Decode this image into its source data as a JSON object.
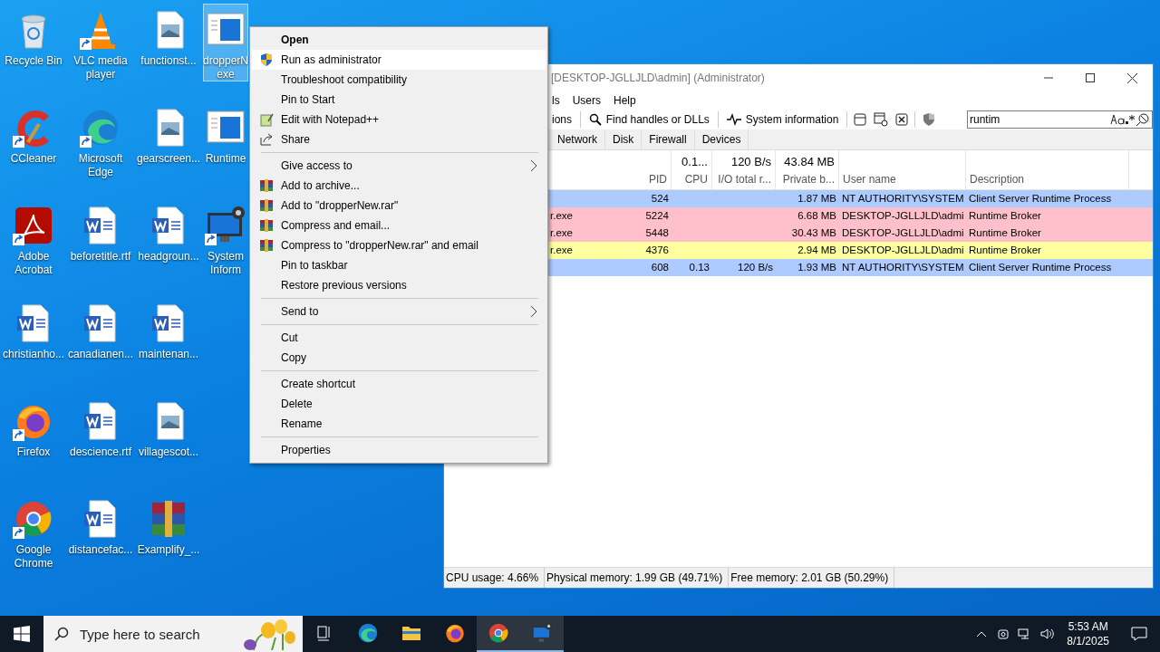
{
  "desktop_icons": [
    {
      "label": "Recycle Bin",
      "kind": "recycle",
      "shortcut": false,
      "selected": false
    },
    {
      "label": "CCleaner",
      "kind": "ccleaner",
      "shortcut": true,
      "selected": false
    },
    {
      "label": "Adobe Acrobat",
      "kind": "acrobat",
      "shortcut": true,
      "selected": false
    },
    {
      "label": "christianho...",
      "kind": "word",
      "shortcut": false,
      "selected": false
    },
    {
      "label": "Firefox",
      "kind": "firefox",
      "shortcut": true,
      "selected": false
    },
    {
      "label": "Google Chrome",
      "kind": "chrome",
      "shortcut": true,
      "selected": false
    },
    {
      "label": "VLC media player",
      "kind": "vlc",
      "shortcut": true,
      "selected": false
    },
    {
      "label": "Microsoft Edge",
      "kind": "edge",
      "shortcut": true,
      "selected": false
    },
    {
      "label": "beforetitle.rtf",
      "kind": "word",
      "shortcut": false,
      "selected": false
    },
    {
      "label": "canadianen...",
      "kind": "word",
      "shortcut": false,
      "selected": false
    },
    {
      "label": "descience.rtf",
      "kind": "word",
      "shortcut": false,
      "selected": false
    },
    {
      "label": "distancefac...",
      "kind": "word",
      "shortcut": false,
      "selected": false
    },
    {
      "label": "functionst...",
      "kind": "image",
      "shortcut": false,
      "selected": false
    },
    {
      "label": "gearscreen...",
      "kind": "image",
      "shortcut": false,
      "selected": false
    },
    {
      "label": "headgroun...",
      "kind": "word",
      "shortcut": false,
      "selected": false
    },
    {
      "label": "maintenan...",
      "kind": "word",
      "shortcut": false,
      "selected": false
    },
    {
      "label": "villagescot...",
      "kind": "image",
      "shortcut": false,
      "selected": false
    },
    {
      "label": "Examplify_...",
      "kind": "winrar",
      "shortcut": false,
      "selected": false
    },
    {
      "label": "dropperN exe",
      "kind": "app",
      "shortcut": false,
      "selected": true
    },
    {
      "label": "Runtime",
      "kind": "app",
      "shortcut": false,
      "selected": false
    },
    {
      "label": "System Inform",
      "kind": "sysinfo",
      "shortcut": true,
      "selected": false
    }
  ],
  "process_window": {
    "title": "[DESKTOP-JGLLJLD\\admin] (Administrator)",
    "menu": [
      "ls",
      "Users",
      "Help"
    ],
    "toolbar": [
      {
        "label": "ions",
        "kind": "text"
      },
      {
        "label": "Find handles or DLLs",
        "kind": "find"
      },
      {
        "label": "System information",
        "kind": "sysinfo"
      }
    ],
    "search": {
      "value": "runtim"
    },
    "tabs": [
      {
        "label": "Network",
        "selected": false
      },
      {
        "label": "Disk",
        "selected": false
      },
      {
        "label": "Firewall",
        "selected": false
      },
      {
        "label": "Devices",
        "selected": false
      }
    ],
    "columns": [
      {
        "label": "PID"
      },
      {
        "label": "CPU",
        "total": "0.1..."
      },
      {
        "label": "I/O total r...",
        "total": "120 B/s"
      },
      {
        "label": "Private b...",
        "total": "43.84 MB"
      },
      {
        "label": "User name"
      },
      {
        "label": "Description"
      }
    ],
    "rows": [
      {
        "pid": "524",
        "private": "1.87 MB",
        "user": "NT AUTHORITY\\SYSTEM",
        "description": "Client Server Runtime Process",
        "color": "#aecbff"
      },
      {
        "name": "r.exe",
        "pid": "5224",
        "private": "6.68 MB",
        "user": "DESKTOP-JGLLJLD\\admi",
        "description": "Runtime Broker",
        "color": "#ffc0cb"
      },
      {
        "name": "r.exe",
        "pid": "5448",
        "private": "30.43 MB",
        "user": "DESKTOP-JGLLJLD\\admi",
        "description": "Runtime Broker",
        "color": "#ffc0cb"
      },
      {
        "name": "r.exe",
        "pid": "4376",
        "private": "2.94 MB",
        "user": "DESKTOP-JGLLJLD\\admi",
        "description": "Runtime Broker",
        "color": "#ffff9f"
      },
      {
        "pid": "608",
        "cpu": "0.13",
        "io": "120 B/s",
        "private": "1.93 MB",
        "user": "NT AUTHORITY\\SYSTEM",
        "description": "Client Server Runtime Process",
        "color": "#aecbff"
      }
    ],
    "status": [
      "CPU usage: 4.66%",
      "Physical memory: 1.99 GB (49.71%)",
      "Free memory: 2.01 GB (50.29%)"
    ]
  },
  "context_menu": {
    "groups": [
      [
        {
          "label": "Open",
          "kind": "plain",
          "default": true,
          "selected": false,
          "submenu": false
        },
        {
          "label": "Run as administrator",
          "kind": "elevate",
          "default": false,
          "selected": true,
          "submenu": false
        },
        {
          "label": "Troubleshoot compatibility",
          "kind": "plain",
          "default": false,
          "selected": false,
          "submenu": false
        },
        {
          "label": "Pin to Start",
          "kind": "plain",
          "default": false,
          "selected": false,
          "submenu": false
        },
        {
          "label": "Edit with Notepad++",
          "kind": "editor",
          "default": false,
          "selected": false,
          "submenu": false
        },
        {
          "label": "Share",
          "kind": "share",
          "default": false,
          "selected": false,
          "submenu": false
        }
      ],
      [
        {
          "label": "Give access to",
          "kind": "plain",
          "default": false,
          "selected": false,
          "submenu": true
        },
        {
          "label": "Add to archive...",
          "kind": "archive",
          "default": false,
          "selected": false,
          "submenu": false
        },
        {
          "label": "Add to \"dropperNew.rar\"",
          "kind": "archive",
          "default": false,
          "selected": false,
          "submenu": false
        },
        {
          "label": "Compress and email...",
          "kind": "archive",
          "default": false,
          "selected": false,
          "submenu": false
        },
        {
          "label": "Compress to \"dropperNew.rar\" and email",
          "kind": "archive",
          "default": false,
          "selected": false,
          "submenu": false
        },
        {
          "label": "Pin to taskbar",
          "kind": "plain",
          "default": false,
          "selected": false,
          "submenu": false
        },
        {
          "label": "Restore previous versions",
          "kind": "plain",
          "default": false,
          "selected": false,
          "submenu": false
        }
      ],
      [
        {
          "label": "Send to",
          "kind": "plain",
          "default": false,
          "selected": false,
          "submenu": true
        }
      ],
      [
        {
          "label": "Cut",
          "kind": "plain",
          "default": false,
          "selected": false,
          "submenu": false
        },
        {
          "label": "Copy",
          "kind": "plain",
          "default": false,
          "selected": false,
          "submenu": false
        }
      ],
      [
        {
          "label": "Create shortcut",
          "kind": "plain",
          "default": false,
          "selected": false,
          "submenu": false
        },
        {
          "label": "Delete",
          "kind": "plain",
          "default": false,
          "selected": false,
          "submenu": false
        },
        {
          "label": "Rename",
          "kind": "plain",
          "default": false,
          "selected": false,
          "submenu": false
        }
      ],
      [
        {
          "label": "Properties",
          "kind": "plain",
          "default": false,
          "selected": false,
          "submenu": false
        }
      ]
    ]
  },
  "taskbar": {
    "search": {
      "placeholder": "Type here to search"
    },
    "apps": [
      {
        "kind": "taskview",
        "active": false
      },
      {
        "kind": "edge",
        "active": false
      },
      {
        "kind": "explorer",
        "active": false
      },
      {
        "kind": "firefox",
        "active": false
      },
      {
        "kind": "chrome",
        "active": true
      },
      {
        "kind": "sysinfo",
        "active": true
      }
    ],
    "time": "5:53 AM",
    "date": "8/1/2025"
  }
}
